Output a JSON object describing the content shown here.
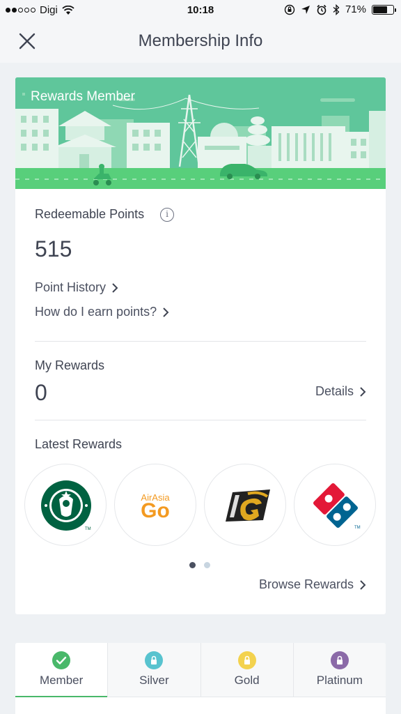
{
  "status_bar": {
    "carrier": "Digi",
    "time": "10:18",
    "battery_percent": "71%",
    "battery_level": 0.71,
    "signal_bars": 2,
    "icons": [
      "wifi-icon",
      "screen-lock-icon",
      "location-arrow-icon",
      "alarm-icon",
      "bluetooth-icon",
      "battery-icon"
    ]
  },
  "nav": {
    "title": "Membership Info",
    "close_icon": "close-icon"
  },
  "banner": {
    "title": "Rewards Member",
    "color": "#5fc69b"
  },
  "points": {
    "label": "Redeemable Points",
    "value": "515",
    "info_icon": "i",
    "history_link": "Point History",
    "earn_link": "How do I earn points?"
  },
  "my_rewards": {
    "label": "My Rewards",
    "value": "0",
    "details_link": "Details"
  },
  "latest_rewards": {
    "label": "Latest Rewards",
    "items": [
      {
        "name": "starbucks-logo",
        "text": "TM"
      },
      {
        "name": "airasia-go-logo",
        "brand": "AirAsia",
        "sub": "Go"
      },
      {
        "name": "gsc-logo"
      },
      {
        "name": "dominos-logo",
        "text": "TM"
      }
    ],
    "page_count": 2,
    "current_page": 1,
    "browse_link": "Browse Rewards"
  },
  "tiers": [
    {
      "label": "Member",
      "color": "#49b86a",
      "icon": "check-icon",
      "active": true
    },
    {
      "label": "Silver",
      "color": "#58c3cf",
      "icon": "lock-icon",
      "active": false
    },
    {
      "label": "Gold",
      "color": "#f3d24e",
      "icon": "lock-icon",
      "active": false
    },
    {
      "label": "Platinum",
      "color": "#8b6aa8",
      "icon": "lock-icon",
      "active": false
    }
  ],
  "accent_color": "#49b86a"
}
